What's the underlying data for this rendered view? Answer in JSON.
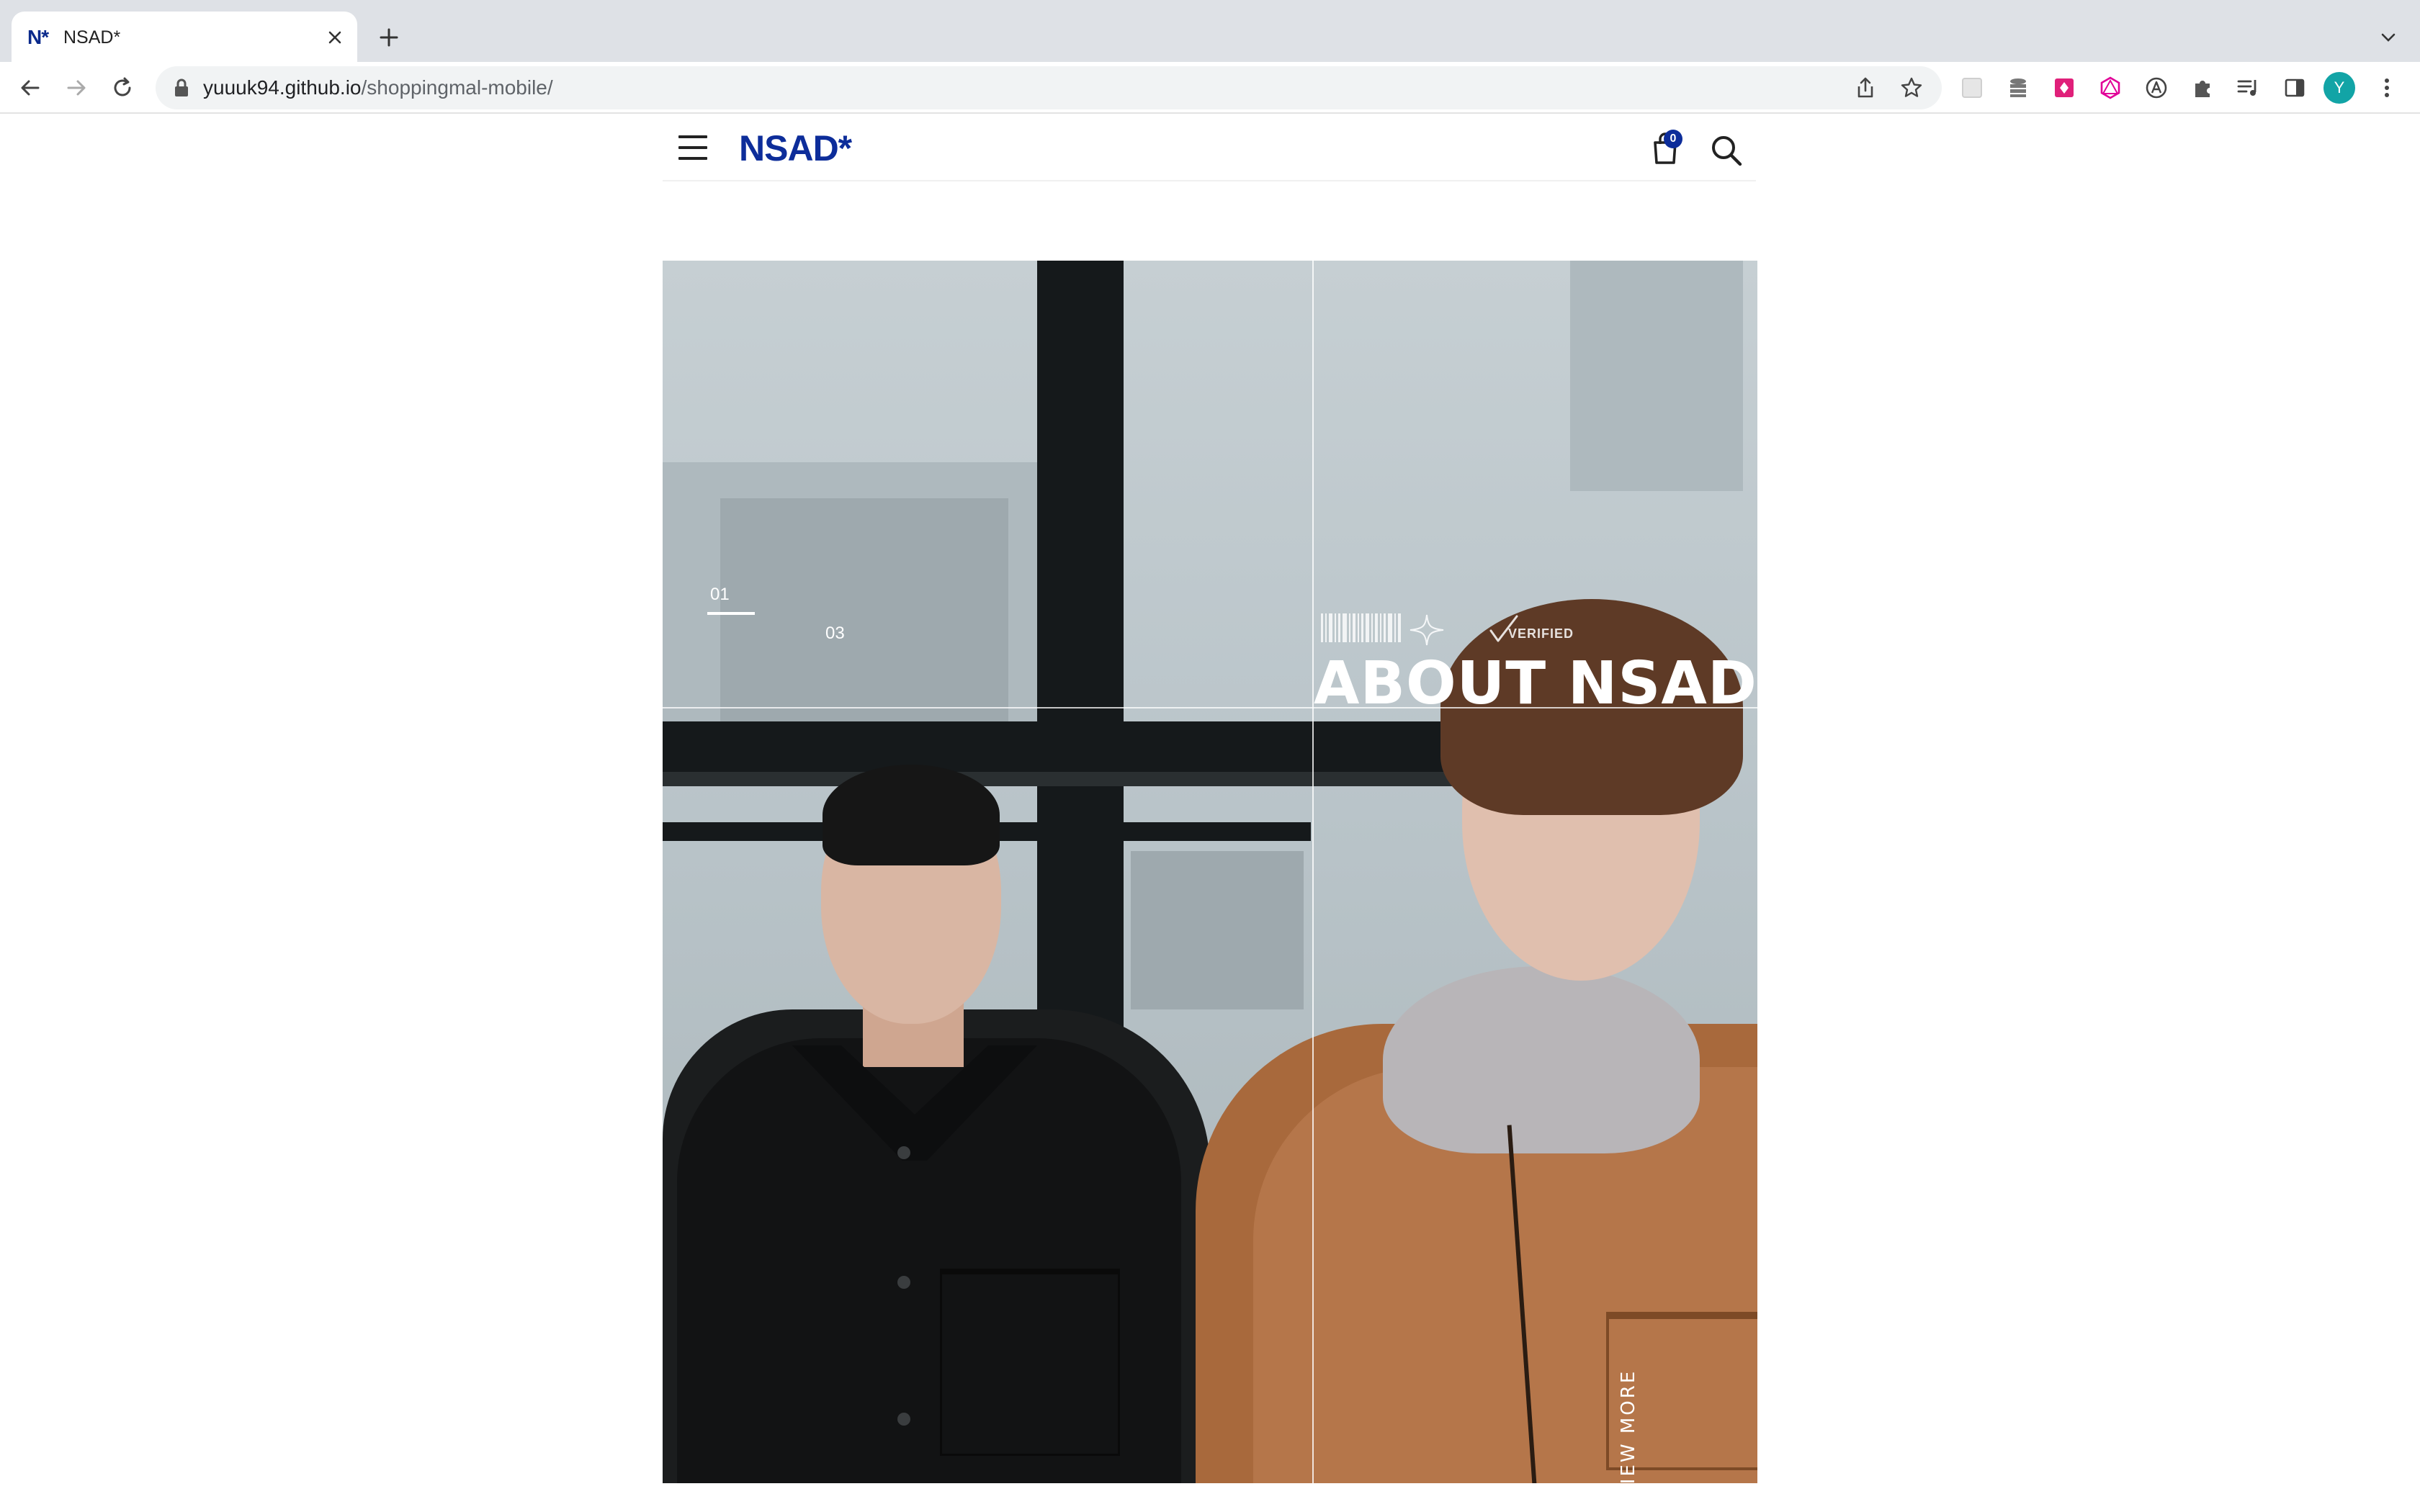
{
  "browser": {
    "tab_title": "NSAD*",
    "tab_favicon": "N*",
    "url_host": "yuuuk94.github.io",
    "url_path": "/shoppingmal-mobile/",
    "profile_initial": "Y"
  },
  "site": {
    "logo": "NSAD*",
    "cart_count": "0",
    "brand_color": "#0d2d9a"
  },
  "hero": {
    "pager_current": "01",
    "pager_total": "03",
    "verified_label": "VERIFIED",
    "title": "ABOUT NSAD*",
    "cta": "VIEW MORE"
  },
  "icons": {
    "back": "arrow-left-icon",
    "forward": "arrow-right-icon",
    "reload": "reload-icon",
    "lock": "lock-icon",
    "share": "share-icon",
    "bookmark": "star-icon",
    "menu": "hamburger-icon",
    "cart": "shopping-bag-icon",
    "search": "search-icon"
  }
}
